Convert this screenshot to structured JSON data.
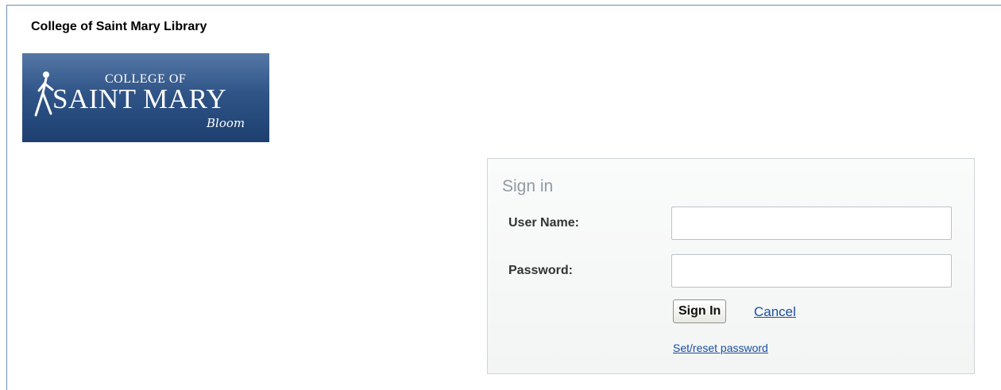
{
  "header": {
    "title": "College of Saint Mary Library"
  },
  "logo": {
    "line1": "COLLEGE OF",
    "line2": "SAINT MARY",
    "tagline": "Bloom",
    "icon": "walking-figure-icon",
    "bg_color": "#2f5487"
  },
  "signin": {
    "title": "Sign in",
    "username_label": "User Name:",
    "username_value": "",
    "password_label": "Password:",
    "password_value": "",
    "submit_label": "Sign In",
    "cancel_label": "Cancel",
    "reset_label": "Set/reset password"
  },
  "colors": {
    "link": "#1a4fa0",
    "panel_title": "#909aa3",
    "frame_border": "#6b8bb8"
  }
}
